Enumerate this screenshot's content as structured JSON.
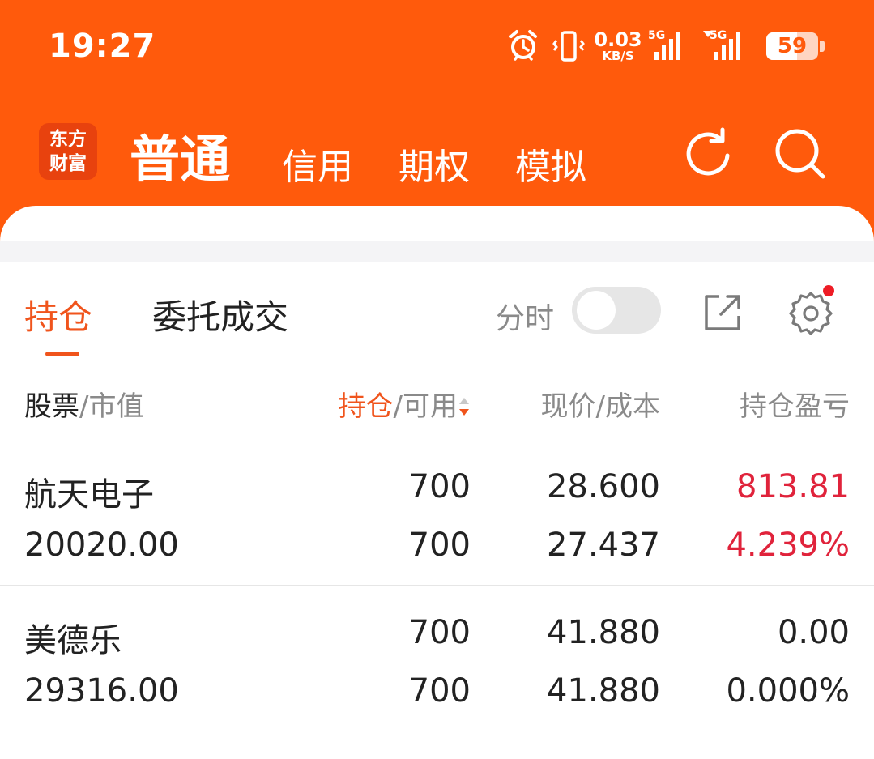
{
  "status_bar": {
    "time": "19:27",
    "net_speed_value": "0.03",
    "net_speed_unit": "KB/S",
    "signal1_label": "5G",
    "signal2_label": "5G",
    "battery": "59",
    "battery_level": 59
  },
  "header": {
    "logo_line1": "东方",
    "logo_line2": "财富",
    "tabs": [
      {
        "label": "普通",
        "active": true
      },
      {
        "label": "信用",
        "active": false
      },
      {
        "label": "期权",
        "active": false
      },
      {
        "label": "模拟",
        "active": false
      }
    ],
    "icons": [
      "refresh-icon",
      "search-icon"
    ]
  },
  "subtabs": {
    "holding": "持仓",
    "orders": "委托成交",
    "split_label": "分时",
    "split_enabled": false
  },
  "columns": {
    "stock": "股票",
    "market_value": "/市值",
    "holding": "持仓",
    "available": "/可用",
    "price": "现价",
    "cost": "/成本",
    "profit": "持仓盈亏"
  },
  "colors": {
    "brand": "#ff5a0c",
    "accent": "#f0541c",
    "gain": "#e0233b"
  },
  "positions": [
    {
      "name": "航天电子",
      "market_value": "20020.00",
      "holding": "700",
      "available": "700",
      "price": "28.600",
      "cost": "27.437",
      "profit": "813.81",
      "profit_pct": "4.239%"
    },
    {
      "name": "美德乐",
      "market_value": "29316.00",
      "holding": "700",
      "available": "700",
      "price": "41.880",
      "cost": "41.880",
      "profit": "0.00",
      "profit_pct": "0.000%"
    }
  ]
}
